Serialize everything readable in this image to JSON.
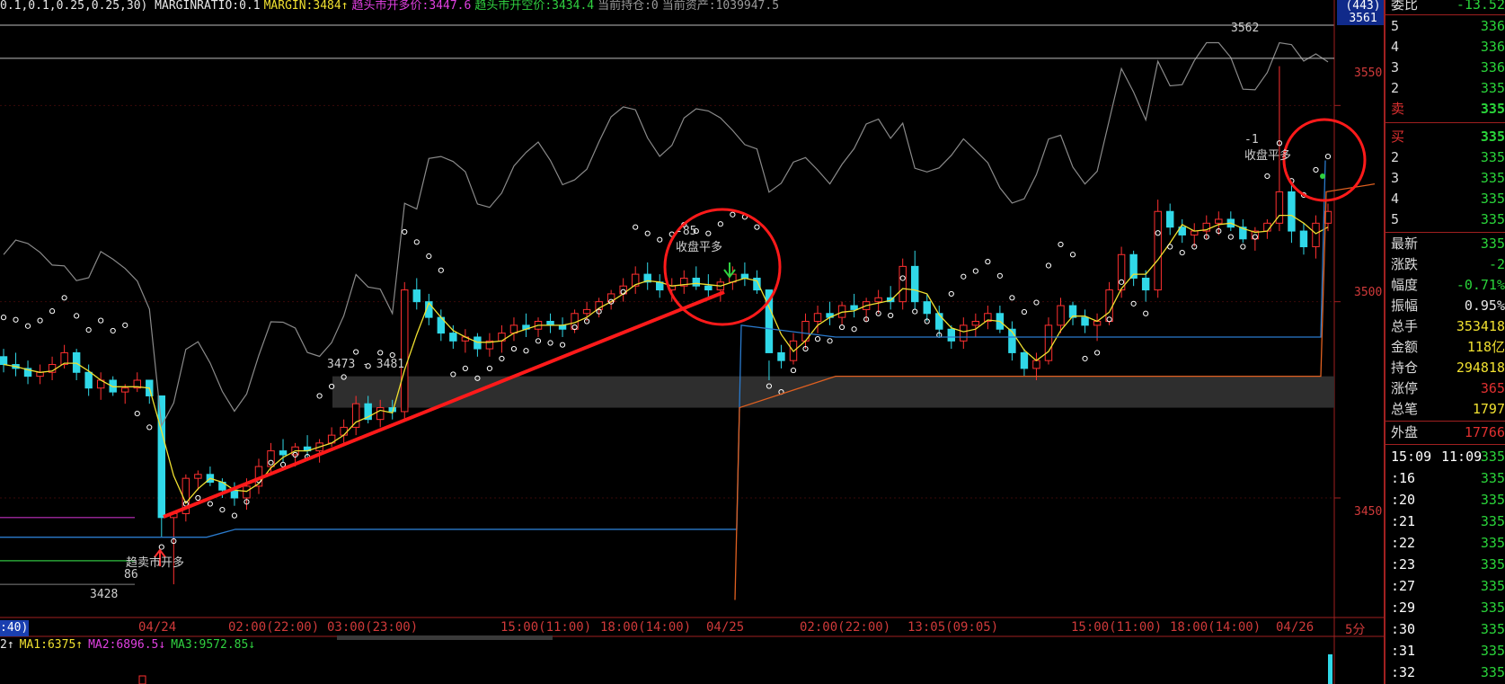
{
  "info_bar": [
    {
      "text": "0.1,0.1,0.25,0.25,30) MARGINRATIO:0.1",
      "color": "#e8e8e8"
    },
    {
      "text": "MARGIN:3484↑",
      "color": "#f0e030"
    },
    {
      "text": "趋头市开多价:3447.6",
      "color": "#e040e0"
    },
    {
      "text": "趋头市开空价:3434.4",
      "color": "#30d040"
    },
    {
      "text": "当前持仓:0",
      "color": "#9a9a9a"
    },
    {
      "text": "当前资产:1039947.5",
      "color": "#9a9a9a"
    }
  ],
  "price_axis": {
    "top_tag_line1": "(443)",
    "top_tag_line2": "3561",
    "labels": [
      "3550",
      "3500",
      "3450"
    ]
  },
  "time_axis": {
    "left_tag": ":40)",
    "labels": [
      "04/24",
      "02:00(22:00)",
      "03:00(23:00)",
      "15:00(11:00)",
      "18:00(14:00)",
      "04/25",
      "02:00(22:00)",
      "13:05(09:05)",
      "15:00(11:00)",
      "18:00(14:00)",
      "04/26"
    ],
    "period": "5分"
  },
  "annotations": {
    "high": "3562",
    "low": "3428",
    "zone": "3473 - 3481",
    "open_signal": "趋卖市开多",
    "open_signal_num": "86",
    "close_signal_1_num": "-85",
    "close_signal_1": "收盘平多",
    "close_signal_2_num": "-1",
    "close_signal_2": "收盘平多"
  },
  "indicator_bar": [
    {
      "text": "2↑",
      "color": "#e8e8e8"
    },
    {
      "text": "MA1:6375↑",
      "color": "#f0e030"
    },
    {
      "text": "MA2:6896.5↓",
      "color": "#e040e0"
    },
    {
      "text": "MA3:9572.85↓",
      "color": "#30d040"
    }
  ],
  "panel": {
    "top_label": "委比",
    "top_value": "-13.52",
    "sell_rows": [
      {
        "label": "5",
        "value": "336"
      },
      {
        "label": "4",
        "value": "336"
      },
      {
        "label": "3",
        "value": "336"
      },
      {
        "label": "2",
        "value": "335"
      },
      {
        "label": "卖",
        "value": "335"
      }
    ],
    "buy_rows": [
      {
        "label": "买",
        "value": "335"
      },
      {
        "label": "2",
        "value": "335"
      },
      {
        "label": "3",
        "value": "335"
      },
      {
        "label": "4",
        "value": "335"
      },
      {
        "label": "5",
        "value": "335"
      }
    ],
    "stats": [
      {
        "label": "最新",
        "value": "335",
        "color": "#2ad43a"
      },
      {
        "label": "涨跌",
        "value": "-2",
        "color": "#2ad43a"
      },
      {
        "label": "幅度",
        "value": "-0.71%",
        "color": "#2ad43a"
      },
      {
        "label": "振幅",
        "value": "0.95%",
        "color": "#e8e8e8"
      },
      {
        "label": "总手",
        "value": "353418",
        "color": "#f0e030"
      },
      {
        "label": "金额",
        "value": "118亿",
        "color": "#f0e030"
      },
      {
        "label": "持仓",
        "value": "294818",
        "color": "#f0e030"
      },
      {
        "label": "涨停",
        "value": "365",
        "color": "#e03030"
      },
      {
        "label": "总笔",
        "value": "1797",
        "color": "#f0e030"
      }
    ],
    "outer_label": "外盘",
    "outer_value": "17766",
    "tick_header": {
      "label": "15:09",
      "time": "11:09",
      "value": "335"
    },
    "ticks": [
      {
        "label": ":16",
        "value": "335"
      },
      {
        "label": ":20",
        "value": "335"
      },
      {
        "label": ":21",
        "value": "335"
      },
      {
        "label": ":22",
        "value": "335"
      },
      {
        "label": ":23",
        "value": "335"
      },
      {
        "label": ":27",
        "value": "335"
      },
      {
        "label": ":29",
        "value": "335"
      },
      {
        "label": ":30",
        "value": "335"
      },
      {
        "label": ":31",
        "value": "335"
      },
      {
        "label": ":32",
        "value": "335"
      }
    ]
  },
  "chart_data": {
    "type": "candlestick",
    "price_range": [
      3420,
      3570
    ],
    "zone_range": [
      3473,
      3481
    ],
    "candles": [
      [
        3486,
        3488,
        3482,
        3484
      ],
      [
        3484,
        3487,
        3481,
        3483
      ],
      [
        3483,
        3485,
        3479,
        3481
      ],
      [
        3481,
        3484,
        3479,
        3482
      ],
      [
        3482,
        3486,
        3480,
        3484
      ],
      [
        3484,
        3489,
        3483,
        3487
      ],
      [
        3487,
        3488,
        3480,
        3482
      ],
      [
        3482,
        3484,
        3476,
        3478
      ],
      [
        3478,
        3482,
        3475,
        3480
      ],
      [
        3480,
        3481,
        3476,
        3477
      ],
      [
        3477,
        3479,
        3474,
        3478
      ],
      [
        3478,
        3482,
        3477,
        3480
      ],
      [
        3480,
        3479,
        3474,
        3476
      ],
      [
        3476,
        3455,
        3440,
        3445
      ],
      [
        3445,
        3446,
        3428,
        3446
      ],
      [
        3446,
        3456,
        3444,
        3455
      ],
      [
        3455,
        3457,
        3452,
        3456
      ],
      [
        3456,
        3458,
        3453,
        3454
      ],
      [
        3454,
        3455,
        3450,
        3452
      ],
      [
        3452,
        3454,
        3448,
        3450
      ],
      [
        3450,
        3455,
        3447,
        3453
      ],
      [
        3453,
        3460,
        3451,
        3458
      ],
      [
        3458,
        3464,
        3456,
        3462
      ],
      [
        3462,
        3465,
        3459,
        3461
      ],
      [
        3461,
        3464,
        3458,
        3463
      ],
      [
        3463,
        3466,
        3460,
        3462
      ],
      [
        3462,
        3465,
        3459,
        3464
      ],
      [
        3464,
        3468,
        3463,
        3466
      ],
      [
        3466,
        3470,
        3464,
        3468
      ],
      [
        3468,
        3476,
        3466,
        3474
      ],
      [
        3474,
        3476,
        3469,
        3470
      ],
      [
        3470,
        3475,
        3468,
        3473
      ],
      [
        3473,
        3475,
        3470,
        3472
      ],
      [
        3472,
        3505,
        3470,
        3503
      ],
      [
        3503,
        3506,
        3498,
        3500
      ],
      [
        3500,
        3502,
        3494,
        3496
      ],
      [
        3496,
        3498,
        3490,
        3492
      ],
      [
        3492,
        3494,
        3488,
        3490
      ],
      [
        3490,
        3493,
        3487,
        3491
      ],
      [
        3491,
        3492,
        3486,
        3488
      ],
      [
        3488,
        3492,
        3486,
        3490
      ],
      [
        3490,
        3494,
        3487,
        3492
      ],
      [
        3492,
        3496,
        3490,
        3494
      ],
      [
        3494,
        3497,
        3491,
        3493
      ],
      [
        3493,
        3496,
        3491,
        3495
      ],
      [
        3495,
        3497,
        3492,
        3494
      ],
      [
        3494,
        3496,
        3491,
        3493
      ],
      [
        3493,
        3498,
        3492,
        3497
      ],
      [
        3497,
        3500,
        3495,
        3498
      ],
      [
        3498,
        3501,
        3496,
        3500
      ],
      [
        3500,
        3503,
        3498,
        3502
      ],
      [
        3502,
        3506,
        3500,
        3504
      ],
      [
        3504,
        3509,
        3502,
        3507
      ],
      [
        3507,
        3510,
        3503,
        3505
      ],
      [
        3505,
        3507,
        3501,
        3503
      ],
      [
        3503,
        3506,
        3500,
        3504
      ],
      [
        3504,
        3508,
        3502,
        3506
      ],
      [
        3506,
        3509,
        3503,
        3504
      ],
      [
        3504,
        3507,
        3501,
        3503
      ],
      [
        3503,
        3506,
        3500,
        3505
      ],
      [
        3505,
        3509,
        3503,
        3507
      ],
      [
        3507,
        3510,
        3504,
        3506
      ],
      [
        3506,
        3508,
        3502,
        3503
      ],
      [
        3503,
        3485,
        3480,
        3487
      ],
      [
        3487,
        3489,
        3483,
        3485
      ],
      [
        3485,
        3492,
        3484,
        3490
      ],
      [
        3490,
        3497,
        3488,
        3495
      ],
      [
        3495,
        3499,
        3492,
        3497
      ],
      [
        3497,
        3500,
        3494,
        3496
      ],
      [
        3496,
        3500,
        3494,
        3499
      ],
      [
        3499,
        3502,
        3496,
        3498
      ],
      [
        3498,
        3501,
        3495,
        3500
      ],
      [
        3500,
        3503,
        3497,
        3501
      ],
      [
        3501,
        3504,
        3498,
        3500
      ],
      [
        3500,
        3511,
        3498,
        3509
      ],
      [
        3509,
        3513,
        3498,
        3500
      ],
      [
        3500,
        3502,
        3495,
        3497
      ],
      [
        3497,
        3499,
        3491,
        3493
      ],
      [
        3493,
        3494,
        3488,
        3490
      ],
      [
        3490,
        3496,
        3488,
        3494
      ],
      [
        3494,
        3497,
        3491,
        3495
      ],
      [
        3495,
        3499,
        3493,
        3497
      ],
      [
        3497,
        3499,
        3492,
        3493
      ],
      [
        3493,
        3495,
        3485,
        3487
      ],
      [
        3487,
        3488,
        3481,
        3483
      ],
      [
        3483,
        3487,
        3480,
        3485
      ],
      [
        3485,
        3496,
        3484,
        3494
      ],
      [
        3494,
        3501,
        3492,
        3499
      ],
      [
        3499,
        3500,
        3494,
        3496
      ],
      [
        3496,
        3498,
        3492,
        3494
      ],
      [
        3494,
        3497,
        3490,
        3495
      ],
      [
        3495,
        3505,
        3494,
        3503
      ],
      [
        3503,
        3514,
        3501,
        3512
      ],
      [
        3512,
        3513,
        3504,
        3506
      ],
      [
        3506,
        3508,
        3500,
        3503
      ],
      [
        3503,
        3526,
        3501,
        3523
      ],
      [
        3523,
        3525,
        3517,
        3519
      ],
      [
        3519,
        3521,
        3515,
        3517
      ],
      [
        3517,
        3520,
        3514,
        3518
      ],
      [
        3518,
        3522,
        3516,
        3520
      ],
      [
        3520,
        3523,
        3517,
        3521
      ],
      [
        3521,
        3523,
        3518,
        3519
      ],
      [
        3519,
        3521,
        3515,
        3516
      ],
      [
        3516,
        3519,
        3513,
        3518
      ],
      [
        3518,
        3521,
        3516,
        3520
      ],
      [
        3520,
        3560,
        3518,
        3528
      ],
      [
        3528,
        3530,
        3515,
        3518
      ],
      [
        3518,
        3520,
        3512,
        3514
      ],
      [
        3514,
        3522,
        3511,
        3520
      ],
      [
        3520,
        3525,
        3518,
        3523
      ]
    ]
  }
}
